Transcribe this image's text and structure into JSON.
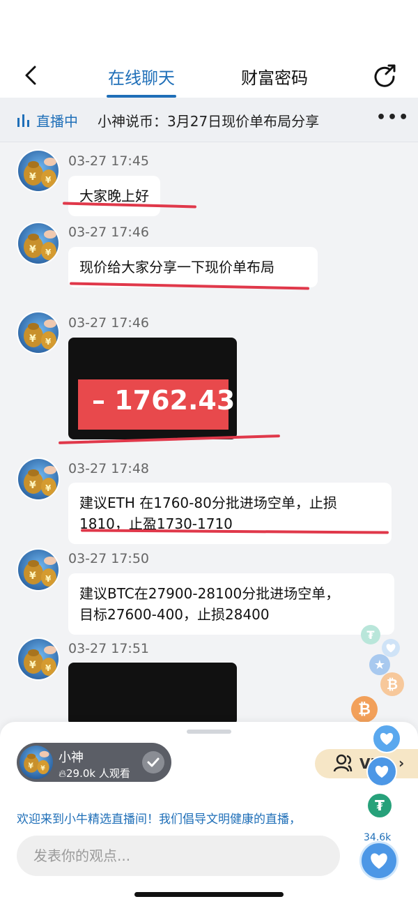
{
  "header": {
    "tabs": [
      {
        "label": "在线聊天",
        "active": true
      },
      {
        "label": "财富密码",
        "active": false
      }
    ]
  },
  "live_bar": {
    "status": "直播中",
    "title": "小神说币：3月27日现价单布局分享"
  },
  "messages": [
    {
      "time": "03-27 17:45",
      "type": "text",
      "lines": [
        "大家晚上好"
      ]
    },
    {
      "time": "03-27 17:46",
      "type": "text",
      "lines": [
        "现价给大家分享一下现价单布局"
      ]
    },
    {
      "time": "03-27 17:46",
      "type": "image",
      "price": "1762.43"
    },
    {
      "time": "03-27 17:48",
      "type": "text",
      "lines": [
        "建议ETH 在1760-80分批进场空单，止损",
        "1810，止盈1730-1710"
      ]
    },
    {
      "time": "03-27 17:50",
      "type": "text",
      "lines": [
        "建议BTC在27900-28100分批进场空单，",
        "目标27600-400，止损28400"
      ]
    },
    {
      "time": "03-27 17:51",
      "type": "image"
    }
  ],
  "host": {
    "name": "小神",
    "viewers": "29.0k 人观看"
  },
  "vip_label": "VIP",
  "welcome_text": "欢迎来到小牛精选直播间！我们倡导文明健康的直播，",
  "comment": {
    "placeholder": "发表你的观点..."
  },
  "like_count": "34.6k",
  "colors": {
    "accent": "#1f6fb8",
    "underline_red": "#e0384a",
    "price_band": "#e8494c"
  }
}
